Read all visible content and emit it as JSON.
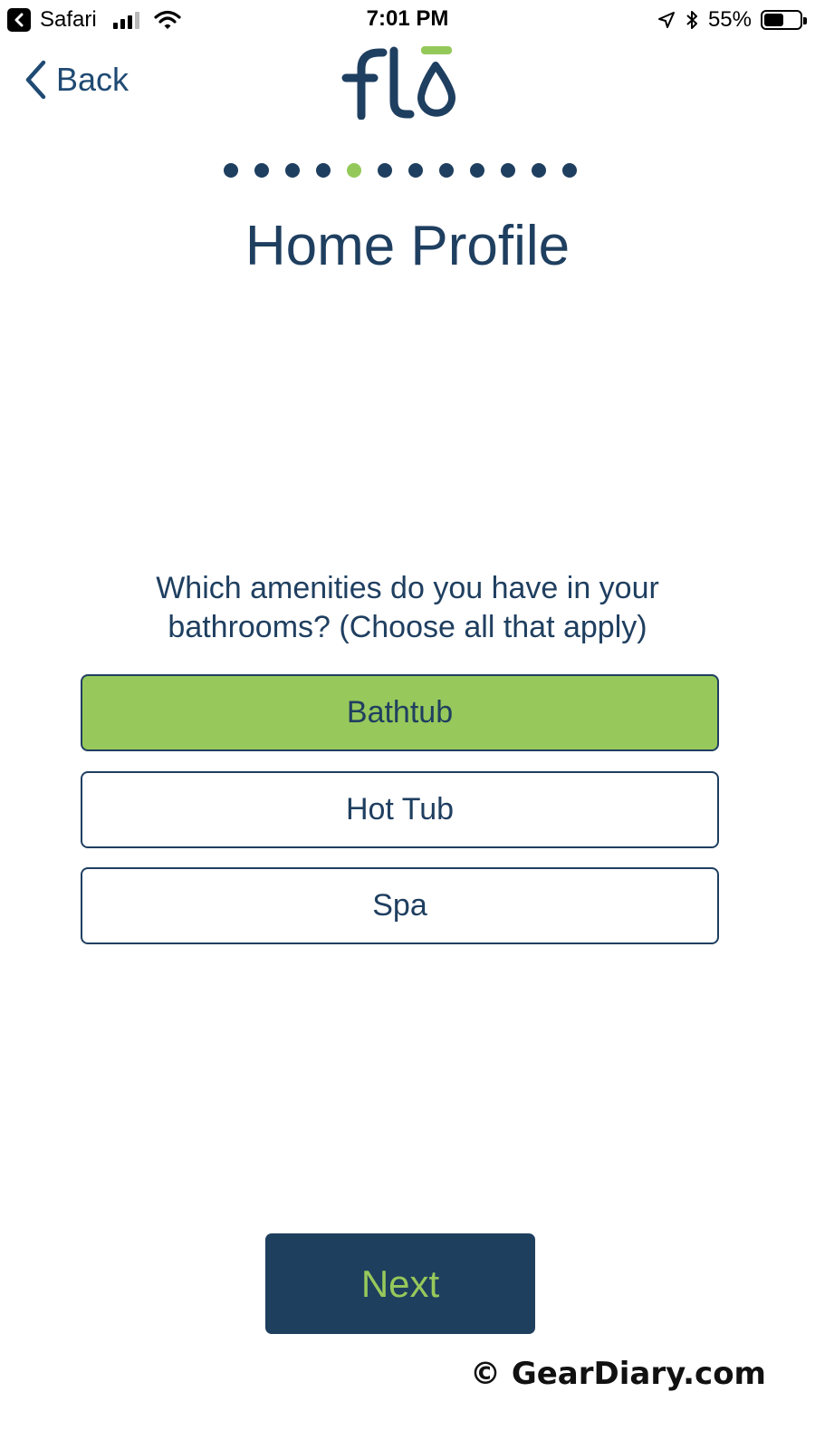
{
  "status_bar": {
    "app": "Safari",
    "time": "7:01 PM",
    "battery": "55%",
    "battery_level": 0.55,
    "signal_bars": 3,
    "signal_total": 4,
    "icons": [
      "back-to-app-icon",
      "cellular-signal-icon",
      "wifi-icon",
      "location-icon",
      "bluetooth-icon",
      "battery-icon"
    ]
  },
  "nav": {
    "back_label": "Back",
    "logo_text": "flō"
  },
  "progress": {
    "total_steps": 12,
    "current_step": 5,
    "active_color": "#94c95a",
    "inactive_color": "#1f3f60"
  },
  "page": {
    "title": "Home Profile",
    "question": "Which amenities do you have in your bathrooms? (Choose all that apply)"
  },
  "options": [
    {
      "label": "Bathtub",
      "selected": true
    },
    {
      "label": "Hot Tub",
      "selected": false
    },
    {
      "label": "Spa",
      "selected": false
    }
  ],
  "next_label": "Next",
  "watermark": "© GearDiary.com",
  "colors": {
    "navy": "#1f3f60",
    "green": "#97c85b",
    "button_bg": "#1e3f5e"
  }
}
